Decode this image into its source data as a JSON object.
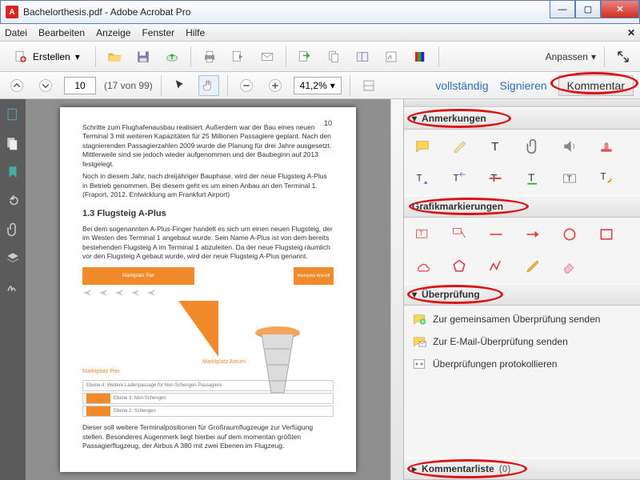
{
  "window": {
    "title": "Bachelorthesis.pdf - Adobe Acrobat Pro"
  },
  "menu": {
    "items": [
      "Datei",
      "Bearbeiten",
      "Anzeige",
      "Fenster",
      "Hilfe"
    ]
  },
  "toolbar": {
    "erstellen": "Erstellen",
    "anpassen": "Anpassen"
  },
  "nav": {
    "page": "10",
    "pagecount": "(17 von 99)",
    "zoom": "41,2%"
  },
  "actions": {
    "vollstaendig": "vollständig",
    "signieren": "Signieren",
    "kommentar": "Kommentar"
  },
  "doc": {
    "pnum": "10",
    "para1": "Schritte zum Flughafenausbau realisiert. Außerdem war der Bau eines neuen Terminal 3 mit weiteren Kapazitäten für 25 Millionen Passagiere geplant. Nach den stagnierenden Passagierzahlen 2009 wurde die Planung für drei Jahre ausgesetzt. Mittlerweile sind sie jedoch wieder aufgenommen und der Baubeginn auf 2013 festgelegt.",
    "para2": "Noch in diesem Jahr, nach dreijähriger Bauphase, wird der neue Flugsteig A-Plus in Betrieb genommen. Bei diesem geht es um einen Anbau an den Terminal 1. (Fraport, 2012, Entwicklung am Frankfurt Airport)",
    "heading": "1.3 Flugsteig A-Plus",
    "para3": "Bei dem sogenannten A-Plus-Finger handelt es sich um einen neuen Flugsteig, der im Westen des Terminal 1 angebaut wurde. Sein Name A-Plus ist von dem bereits bestehenden Flugsteig A im Terminal 1 abzuleiten. Da der neue Flugsteig räumlich vor den Flugsteig A gebaut wurde, wird der neue Flugsteig A-Plus genannt.",
    "figlabel1": "Marktplatz Pier",
    "figlabel2": "Marktplatz Atrium",
    "bar1": "Ebene 4: Weitere Ladenpassage für Non-Schengen Passagiere",
    "bar2": "Ebene 3: Non-Schengen",
    "bar3": "Ebene 2: Schengen",
    "para4": "Dieser soll weitere Terminalpositionen für Großraumflugzeuge zur Verfügung stellen. Besonderes Augenmerk liegt hierbei auf dem momentan größten Passagierflugzeug, der Airbus A 380 mit zwei Ebenen im Flugzeug."
  },
  "panel": {
    "anmerkungen": "Anmerkungen",
    "grafik": "Grafikmarkierungen",
    "ueberpruefung": "Überprüfung",
    "review1": "Zur gemeinsamen Überprüfung senden",
    "review2": "Zur E-Mail-Überprüfung senden",
    "review3": "Überprüfungen protokollieren",
    "kommentarliste": "Kommentarliste"
  }
}
